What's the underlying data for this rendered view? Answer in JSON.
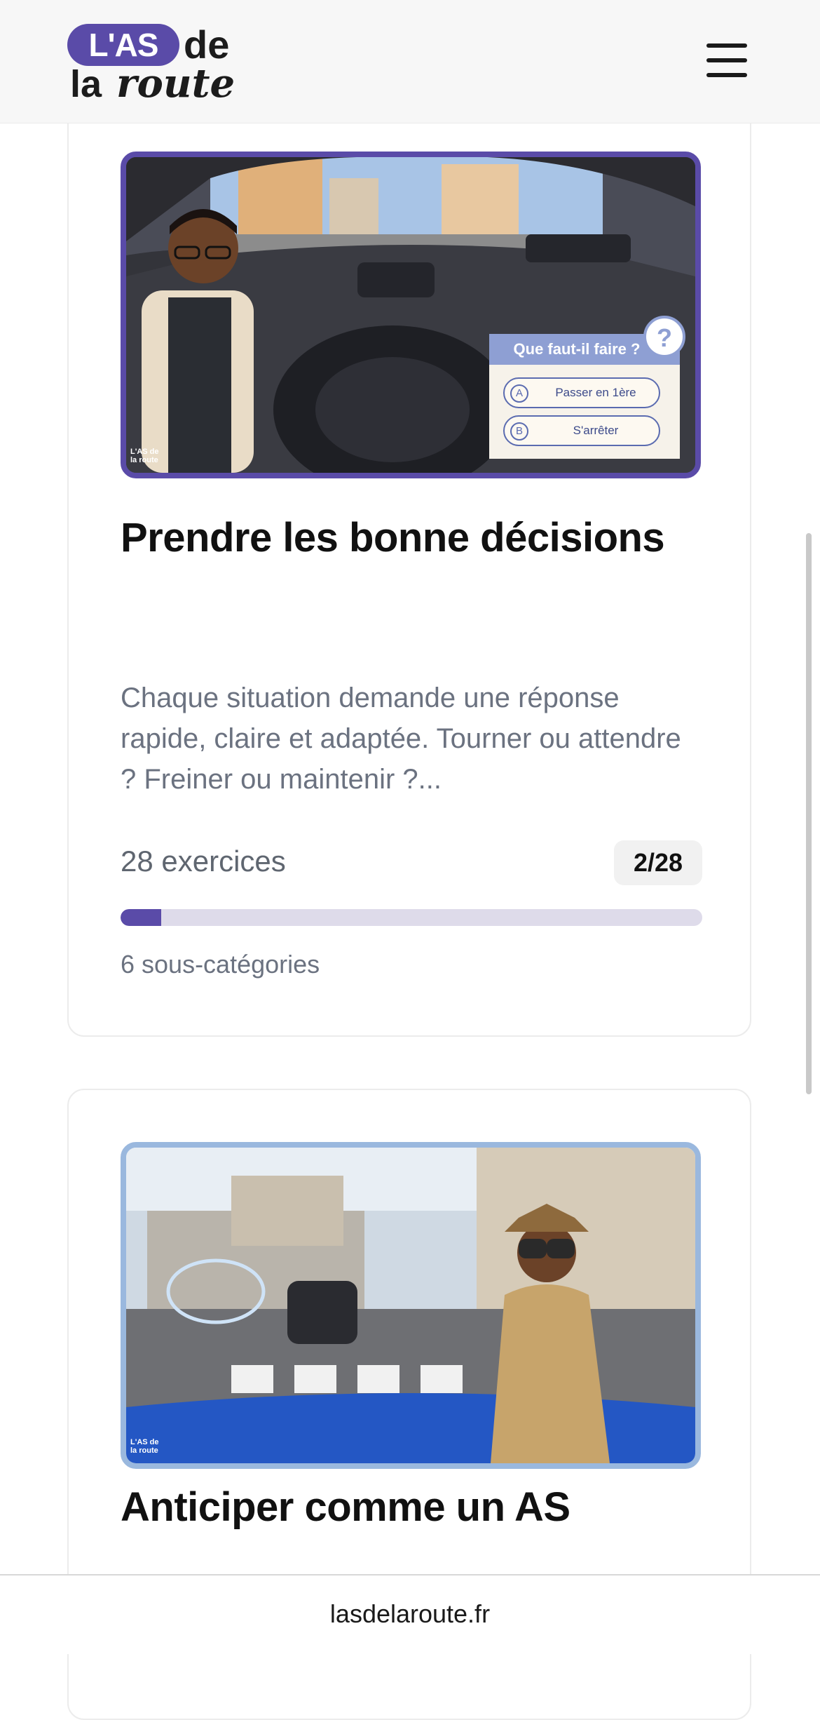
{
  "header": {
    "logo_pill": "L'AS",
    "logo_de": "de",
    "logo_la": "la",
    "logo_route": "route",
    "menu_icon": "hamburger-menu-icon"
  },
  "cards": [
    {
      "title": "Prendre les bonne décisions",
      "description": "Chaque situation demande une réponse rapide, claire et adaptée. Tourner ou attendre ? Freiner ou maintenir ?...",
      "exercise_count": "28 exercices",
      "progress_badge": "2/28",
      "progress_fraction": 0.07,
      "subcategories": "6 sous-catégories",
      "image": {
        "quiz_title": "Que faut-il faire ?",
        "option_a_letter": "A",
        "option_a": "Passer en 1ère",
        "option_b_letter": "B",
        "option_b": "S'arrêter",
        "watermark_top": "L'AS de",
        "watermark_bottom": "la route"
      }
    },
    {
      "title": "Anticiper comme un AS",
      "image": {
        "watermark_top": "L'AS de",
        "watermark_bottom": "la route"
      }
    }
  ],
  "footer": {
    "url": "lasdelaroute.fr"
  },
  "colors": {
    "brand": "#5a4ba8",
    "progress_track": "#dedbea",
    "muted_text": "#6b7280"
  }
}
